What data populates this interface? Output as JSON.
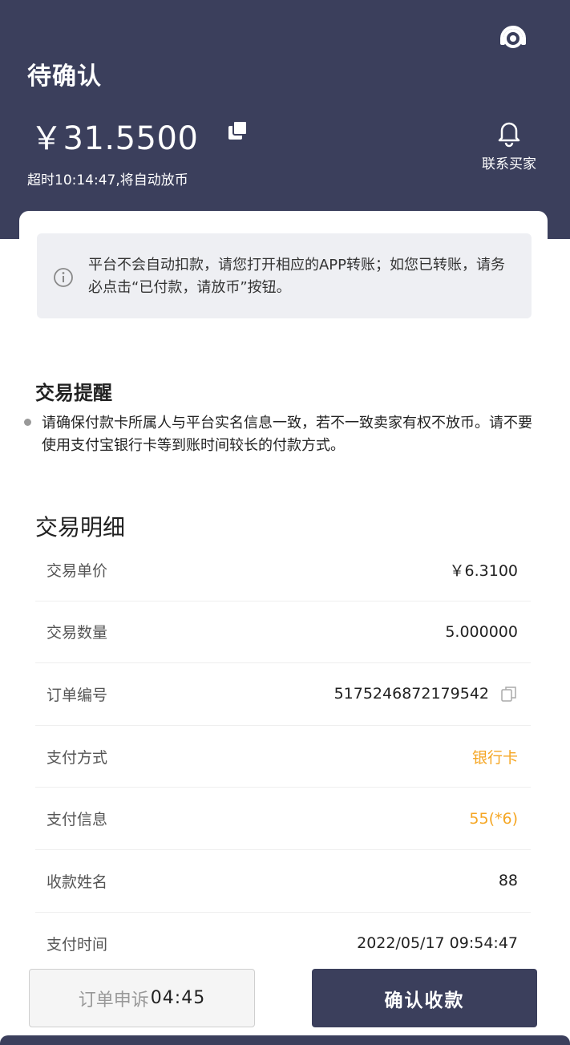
{
  "header": {
    "status": "待确认",
    "amount": "￥31.5500",
    "timeout": "超时10:14:47,将自动放币",
    "contact_label": "联系买家"
  },
  "notice": {
    "text": "平台不会自动扣款，请您打开相应的APP转账；如您已转账，请务必点击“已付款，请放币”按钮。"
  },
  "reminder": {
    "title": "交易提醒",
    "text": "请确保付款卡所属人与平台实名信息一致，若不一致卖家有权不放币。请不要使用支付宝银行卡等到账时间较长的付款方式。"
  },
  "details": {
    "title": "交易明细",
    "rows": [
      {
        "label": "交易单价",
        "value": "￥6.3100"
      },
      {
        "label": "交易数量",
        "value": "5.000000"
      },
      {
        "label": "订单编号",
        "value": "5175246872179542"
      },
      {
        "label": "支付方式",
        "value": "银行卡"
      },
      {
        "label": "支付信息",
        "value": "55(*6)"
      },
      {
        "label": "收款姓名",
        "value": "88"
      },
      {
        "label": "支付时间",
        "value": "2022/05/17 09:54:47"
      }
    ]
  },
  "actions": {
    "appeal_label": "订单申诉",
    "appeal_timer": "04:45",
    "confirm_label": "确认收款"
  },
  "colors": {
    "header_bg": "#3b3f5c",
    "accent_orange": "#f5a623",
    "notice_bg": "#eeeff3"
  },
  "icons": [
    "customer-service-icon",
    "copy-icon",
    "bell-icon",
    "info-icon"
  ]
}
